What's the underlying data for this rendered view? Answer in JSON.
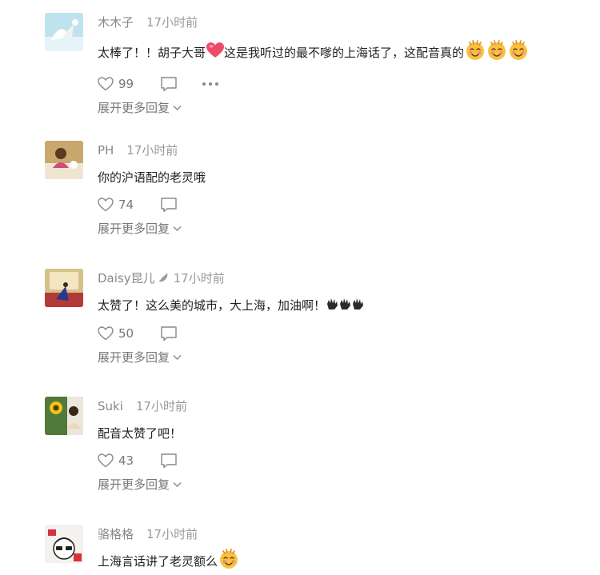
{
  "comments": [
    {
      "user": "木木子",
      "time": "17小时前",
      "text": "太棒了！！胡子大哥",
      "text2": "这是我听过的最不嗲的上海话了，这配音真的",
      "likes": "99",
      "expand": "展开更多回复",
      "has_more": true
    },
    {
      "user": "PH",
      "time": "17小时前",
      "text": "你的沪语配的老灵哦",
      "likes": "74",
      "expand": "展开更多回复"
    },
    {
      "user": "Daisy昆儿",
      "time": "17小时前",
      "text": "太赞了！这么美的城市，大上海，加油啊！",
      "likes": "50",
      "expand": "展开更多回复"
    },
    {
      "user": "Suki",
      "time": "17小时前",
      "text": "配音太赞了吧！",
      "likes": "43",
      "expand": "展开更多回复"
    },
    {
      "user": "骆格格",
      "time": "17小时前",
      "text": "上海言话讲了老灵额么"
    }
  ],
  "colors": {
    "meta": "#888888",
    "text": "#222222",
    "heart_emoji": "#f04a6a",
    "emoji_face": "#f7c242"
  },
  "icons": [
    "heart-outline-icon",
    "comment-bubble-icon",
    "more-dots-icon",
    "chevron-down-icon",
    "heart-emoji-icon",
    "blush-grin-emoji-icon",
    "clap-emoji-icon",
    "verified-badge-icon"
  ]
}
